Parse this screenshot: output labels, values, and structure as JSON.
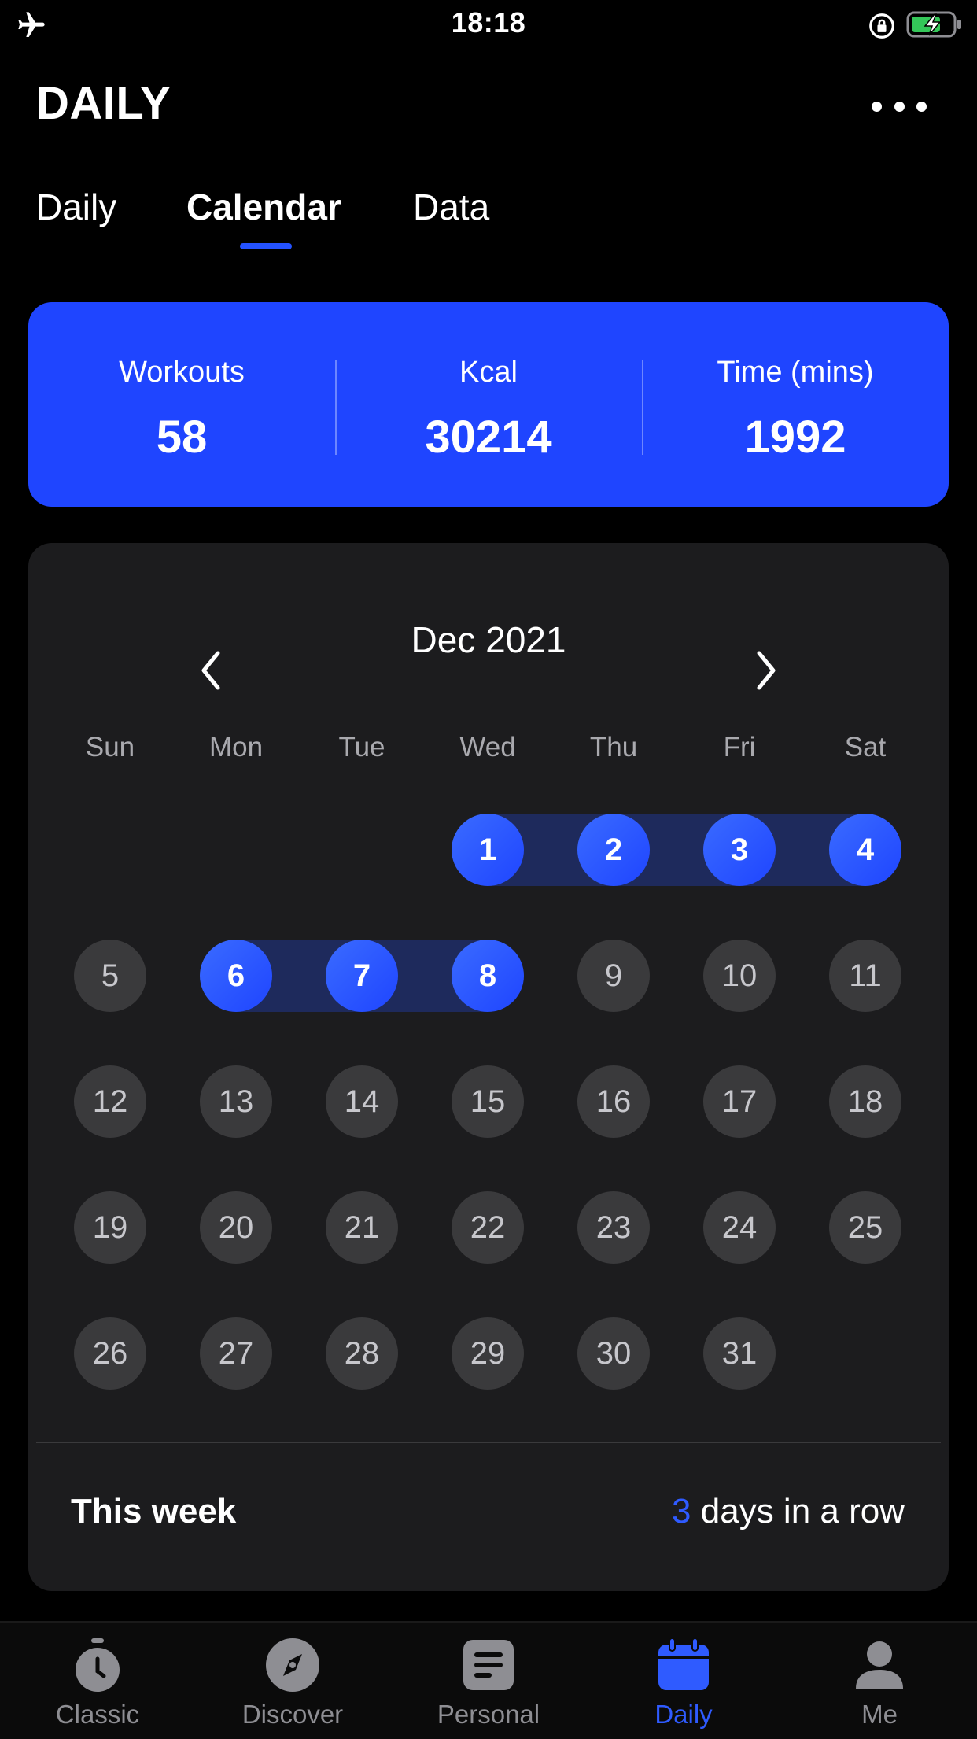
{
  "status_bar": {
    "time": "18:18"
  },
  "header": {
    "title": "DAILY"
  },
  "tabs": [
    {
      "label": "Daily",
      "active": false
    },
    {
      "label": "Calendar",
      "active": true
    },
    {
      "label": "Data",
      "active": false
    }
  ],
  "stats": [
    {
      "label": "Workouts",
      "value": "58"
    },
    {
      "label": "Kcal",
      "value": "30214"
    },
    {
      "label": "Time (mins)",
      "value": "1992"
    }
  ],
  "calendar": {
    "month_label": "Dec 2021",
    "weekdays": [
      "Sun",
      "Mon",
      "Tue",
      "Wed",
      "Thu",
      "Fri",
      "Sat"
    ],
    "first_weekday_index": 3,
    "days_in_month": 31,
    "completed_days": [
      1,
      2,
      3,
      4,
      6,
      7,
      8
    ],
    "accent_color": "#1f45ff"
  },
  "this_week": {
    "title": "This week",
    "streak_count": "3",
    "streak_suffix": " days in a row"
  },
  "bottom_nav": [
    {
      "label": "Classic",
      "icon": "stopwatch-icon",
      "active": false
    },
    {
      "label": "Discover",
      "icon": "compass-icon",
      "active": false
    },
    {
      "label": "Personal",
      "icon": "document-icon",
      "active": false
    },
    {
      "label": "Daily",
      "icon": "calendar-icon",
      "active": true
    },
    {
      "label": "Me",
      "icon": "person-icon",
      "active": false
    }
  ]
}
